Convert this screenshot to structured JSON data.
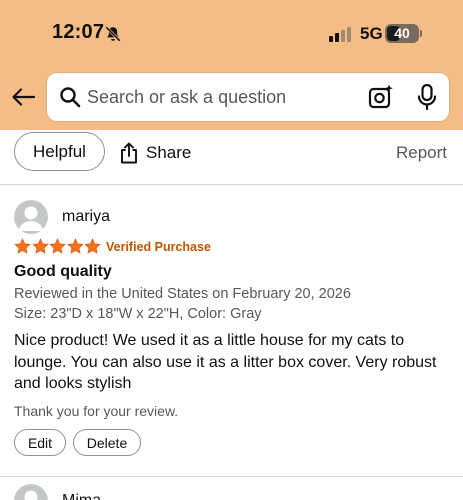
{
  "status_bar": {
    "time": "12:07",
    "network": "5G",
    "battery": "40"
  },
  "search": {
    "placeholder": "Search or ask a question"
  },
  "actions": {
    "helpful_label": "Helpful",
    "share_label": "Share",
    "report_label": "Report"
  },
  "review": {
    "reviewer": "mariya",
    "rating": 5,
    "verified_label": "Verified Purchase",
    "title": "Good quality",
    "date_line": "Reviewed in the United States on February 20, 2026",
    "variant_line": "Size: 23\"D x 18\"W x 22\"H, Color: Gray",
    "body": "Nice product! We used it as a little house for my cats to lounge. You can also use it as a litter box cover. Very robust and looks stylish",
    "thanks": "Thank you for your review.",
    "edit_label": "Edit",
    "delete_label": "Delete"
  },
  "next_review": {
    "reviewer": "Mima"
  },
  "colors": {
    "header_bg": "#f4bd86",
    "star": "#f3731c",
    "verified": "#c45500"
  },
  "icons": [
    "bell-slash-icon",
    "signal-icon",
    "battery-icon",
    "back-arrow-icon",
    "search-icon",
    "camera-lens-icon",
    "microphone-icon",
    "share-icon",
    "user-avatar-icon",
    "star-icon"
  ]
}
